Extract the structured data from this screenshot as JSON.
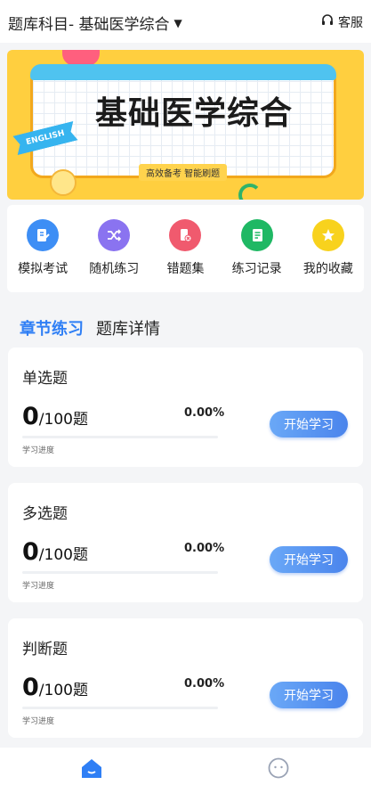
{
  "header": {
    "subject_label": "题库科目- 基础医学综合",
    "subject_dropdown_icon": "caret-down-icon",
    "service_label": "客服",
    "service_icon": "headset-icon"
  },
  "banner": {
    "title": "基础医学综合",
    "tagline": "高效备考  智能刷题",
    "badge": "ENGLISH",
    "colors": {
      "background": "#ffcf3f",
      "frame": "#f2a81d",
      "board_top": "#4fc3f0"
    }
  },
  "menu": {
    "items": [
      {
        "label": "模拟考试",
        "icon": "edit-paper-icon",
        "color": "#3d8ef5"
      },
      {
        "label": "随机练习",
        "icon": "shuffle-icon",
        "color": "#8a73f0"
      },
      {
        "label": "错题集",
        "icon": "wrong-answer-icon",
        "color": "#f05a6e"
      },
      {
        "label": "练习记录",
        "icon": "record-icon",
        "color": "#1fb864"
      },
      {
        "label": "我的收藏",
        "icon": "star-icon",
        "color": "#f8d21d"
      }
    ]
  },
  "tabs": [
    {
      "label": "章节练习",
      "active": true
    },
    {
      "label": "题库详情",
      "active": false
    }
  ],
  "cards": [
    {
      "title": "单选题",
      "done": "0",
      "total": "/100题",
      "percent": "0.00%",
      "progress_value": 0,
      "progress_label": "学习进度",
      "button": "开始学习"
    },
    {
      "title": "多选题",
      "done": "0",
      "total": "/100题",
      "percent": "0.00%",
      "progress_value": 0,
      "progress_label": "学习进度",
      "button": "开始学习"
    },
    {
      "title": "判断题",
      "done": "0",
      "total": "/100题",
      "percent": "0.00%",
      "progress_value": 0,
      "progress_label": "学习进度",
      "button": "开始学习"
    }
  ],
  "bottom_nav": [
    {
      "icon": "home-icon",
      "active": true,
      "color": "#2f7ff5"
    },
    {
      "icon": "chat-icon",
      "active": false,
      "color": "#9aa3b5"
    }
  ],
  "colors": {
    "accent": "#2f7ff5",
    "button_gradient_start": "#6aa8f7",
    "button_gradient_end": "#4a84ec"
  }
}
